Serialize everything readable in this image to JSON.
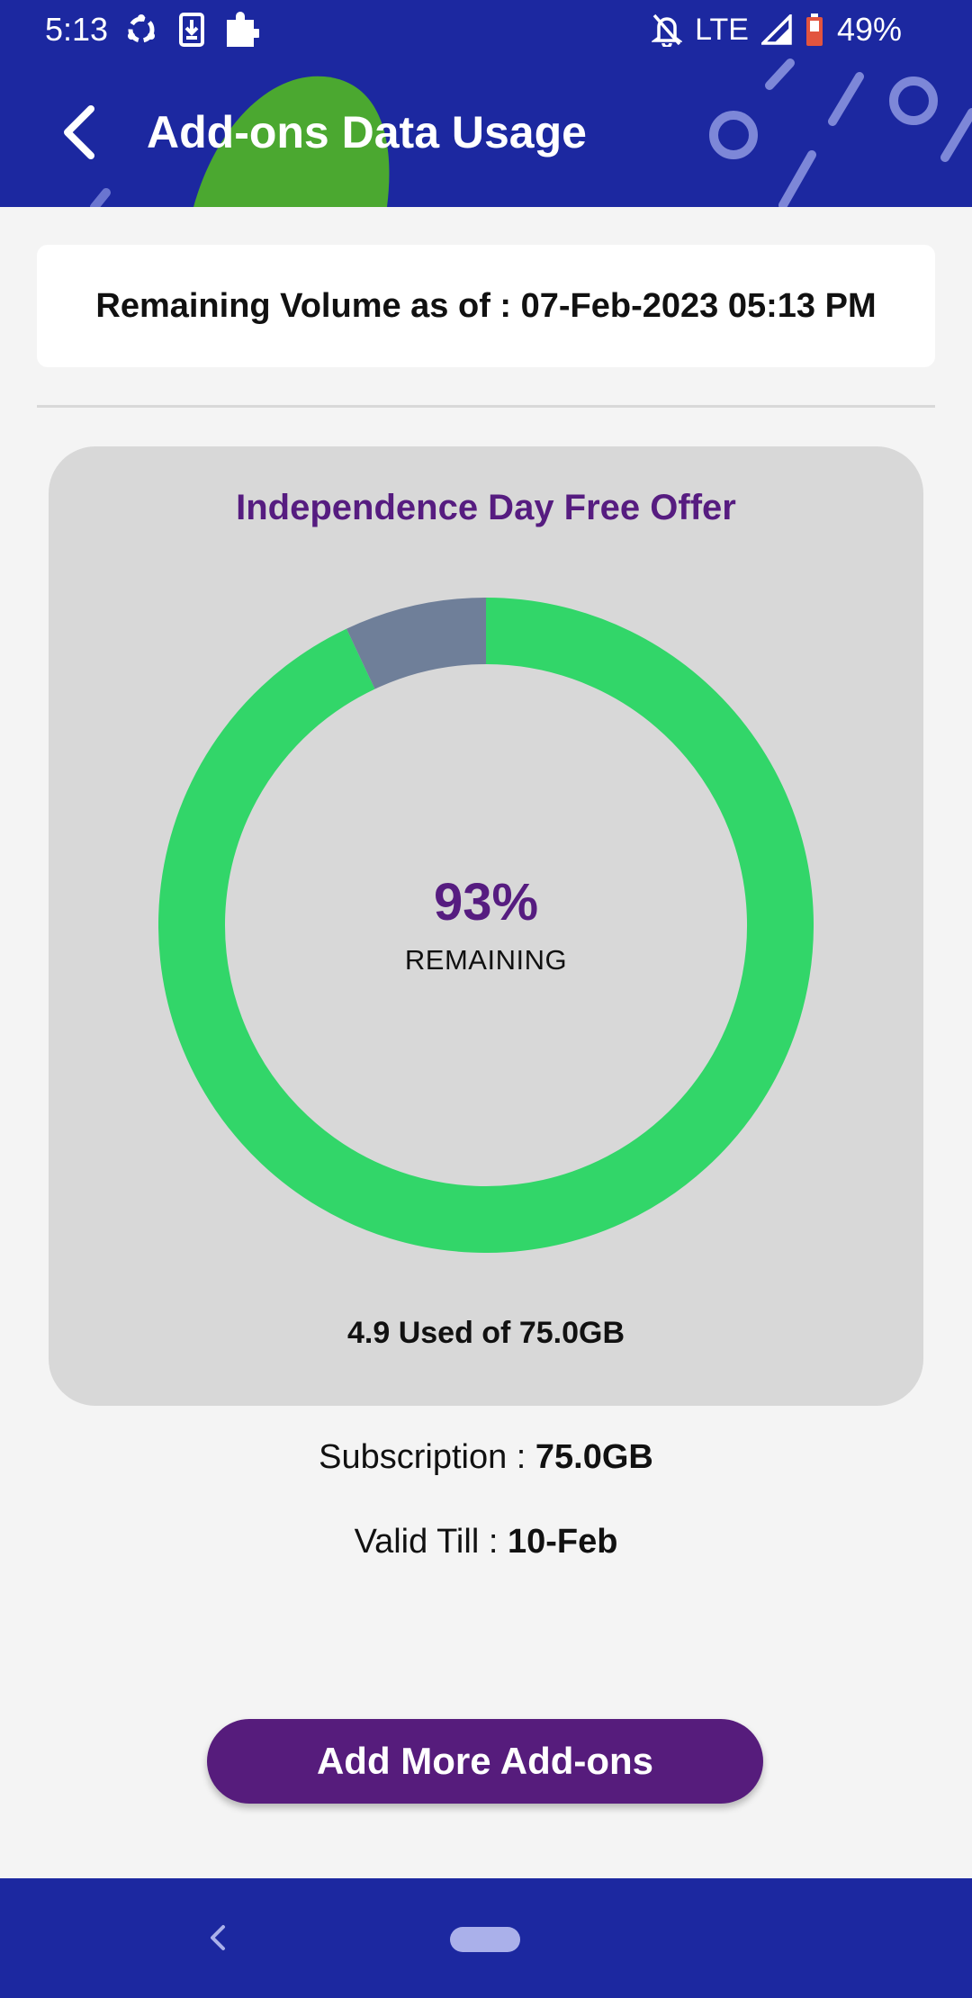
{
  "status_bar": {
    "time": "5:13",
    "network": "LTE",
    "battery": "49%",
    "left_icons": [
      "sync-icon",
      "download-icon",
      "puzzle-icon"
    ],
    "right_icons": [
      "bell-off-icon",
      "signal-icon",
      "battery-icon"
    ]
  },
  "app_bar": {
    "title": "Add-ons Data Usage"
  },
  "volume": {
    "text": "Remaining Volume as of : 07-Feb-2023 05:13 PM"
  },
  "usage": {
    "offer_title": "Independence Day Free Offer",
    "percent": "93%",
    "remaining_label": "REMAINING",
    "used_text": "4.9 Used of 75.0GB"
  },
  "chart_data": {
    "type": "pie",
    "style": "donut",
    "slices": [
      {
        "label": "Remaining",
        "value": 93,
        "color": "#32d669"
      },
      {
        "label": "Used",
        "value": 7,
        "color": "#6f7f99"
      }
    ]
  },
  "subscription": {
    "label": "Subscription : ",
    "value": "75.0GB"
  },
  "validity": {
    "label": "Valid Till : ",
    "value": "10-Feb"
  },
  "actions": {
    "add_more_label": "Add More Add-ons"
  },
  "colors": {
    "primary": "#1c28a0",
    "accent_purple": "#561c80",
    "remaining_green": "#32d669",
    "used_gray": "#6f7f99"
  }
}
